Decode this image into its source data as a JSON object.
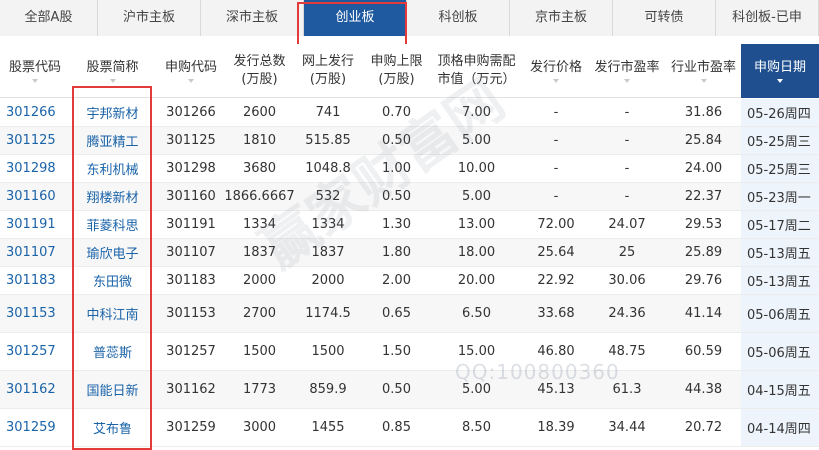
{
  "tabs": [
    {
      "label": "全部A股",
      "active": false
    },
    {
      "label": "沪市主板",
      "active": false
    },
    {
      "label": "深市主板",
      "active": false
    },
    {
      "label": "创业板",
      "active": true
    },
    {
      "label": "科创板",
      "active": false
    },
    {
      "label": "京市主板",
      "active": false
    },
    {
      "label": "可转债",
      "active": false
    },
    {
      "label": "科创板-已申",
      "active": false
    }
  ],
  "headers": {
    "code": "股票代码",
    "name": "股票简称",
    "apply_code": "申购代码",
    "total_issue_1": "发行总数",
    "total_issue_2": "(万股)",
    "online_issue_1": "网上发行",
    "online_issue_2": "(万股)",
    "limit_1": "申购上限",
    "limit_2": "(万股)",
    "market_value_1": "顶格申购需配",
    "market_value_2": "市值（万元）",
    "price": "发行价格",
    "pe": "发行市盈率",
    "industry_pe": "行业市盈率",
    "date": "申购日期"
  },
  "rows": [
    {
      "code": "301266",
      "name": "宇邦新材",
      "apply_code": "301266",
      "total": "2600",
      "online": "741",
      "limit": "0.70",
      "mv": "7.00",
      "price": "-",
      "pe": "-",
      "ipe": "31.86",
      "date": "05-26周四"
    },
    {
      "code": "301125",
      "name": "腾亚精工",
      "apply_code": "301125",
      "total": "1810",
      "online": "515.85",
      "limit": "0.50",
      "mv": "5.00",
      "price": "-",
      "pe": "-",
      "ipe": "25.84",
      "date": "05-25周三"
    },
    {
      "code": "301298",
      "name": "东利机械",
      "apply_code": "301298",
      "total": "3680",
      "online": "1048.8",
      "limit": "1.00",
      "mv": "10.00",
      "price": "-",
      "pe": "-",
      "ipe": "24.00",
      "date": "05-25周三"
    },
    {
      "code": "301160",
      "name": "翔楼新材",
      "apply_code": "301160",
      "total": "1866.6667",
      "online": "532",
      "limit": "0.50",
      "mv": "5.00",
      "price": "-",
      "pe": "-",
      "ipe": "22.37",
      "date": "05-23周一"
    },
    {
      "code": "301191",
      "name": "菲菱科思",
      "apply_code": "301191",
      "total": "1334",
      "online": "1334",
      "limit": "1.30",
      "mv": "13.00",
      "price": "72.00",
      "pe": "24.07",
      "ipe": "29.53",
      "date": "05-17周二"
    },
    {
      "code": "301107",
      "name": "瑜欣电子",
      "apply_code": "301107",
      "total": "1837",
      "online": "1837",
      "limit": "1.80",
      "mv": "18.00",
      "price": "25.64",
      "pe": "25",
      "ipe": "25.89",
      "date": "05-13周五"
    },
    {
      "code": "301183",
      "name": "东田微",
      "apply_code": "301183",
      "total": "2000",
      "online": "2000",
      "limit": "2.00",
      "mv": "20.00",
      "price": "22.92",
      "pe": "30.06",
      "ipe": "29.76",
      "date": "05-13周五"
    },
    {
      "code": "301153",
      "name": "中科江南",
      "apply_code": "301153",
      "total": "2700",
      "online": "1174.5",
      "limit": "0.65",
      "mv": "6.50",
      "price": "33.68",
      "pe": "24.36",
      "ipe": "41.14",
      "date": "05-06周五"
    },
    {
      "code": "301257",
      "name": "普蕊斯",
      "apply_code": "301257",
      "total": "1500",
      "online": "1500",
      "limit": "1.50",
      "mv": "15.00",
      "price": "46.80",
      "pe": "48.75",
      "ipe": "60.59",
      "date": "05-06周五"
    },
    {
      "code": "301162",
      "name": "国能日新",
      "apply_code": "301162",
      "total": "1773",
      "online": "859.9",
      "limit": "0.50",
      "mv": "5.00",
      "price": "45.13",
      "pe": "61.3",
      "ipe": "44.38",
      "date": "04-15周五"
    },
    {
      "code": "301259",
      "name": "艾布鲁",
      "apply_code": "301259",
      "total": "3000",
      "online": "1455",
      "limit": "0.85",
      "mv": "8.50",
      "price": "18.39",
      "pe": "34.44",
      "ipe": "20.72",
      "date": "04-14周四"
    }
  ],
  "watermark": {
    "text": "赢家财富网",
    "qq": "QQ:100800360"
  },
  "colors": {
    "accent": "#1f5aa0",
    "link": "#1a63a8",
    "highlight": "#e43a3a"
  }
}
